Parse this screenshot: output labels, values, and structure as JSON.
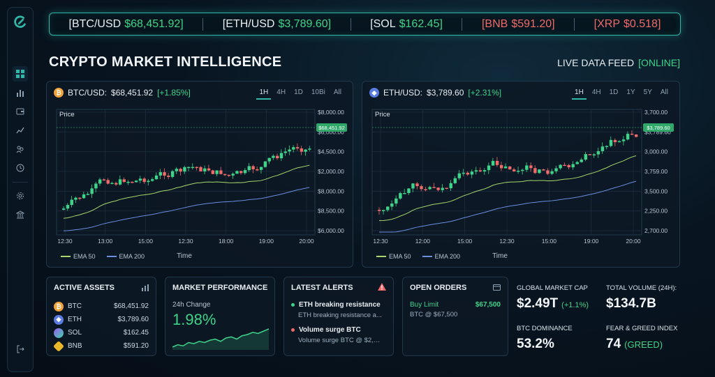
{
  "ticker": [
    {
      "pair": "[BTC/USD",
      "price": "$68,451.92]",
      "trend": "up"
    },
    {
      "pair": "[ETH/USD",
      "price": "$3,789.60]",
      "trend": "up"
    },
    {
      "pair": "[SOL",
      "price": "$162.45]",
      "trend": "up"
    },
    {
      "pair": "[BNB",
      "price": "$591.20]",
      "trend": "down"
    },
    {
      "pair": "[XRP",
      "price": "$0.518]",
      "trend": "down"
    }
  ],
  "page_title": "CRYPTO MARKET INTELLIGENCE",
  "live_feed": {
    "label": "LIVE DATA FEED",
    "status": "[ONLINE]"
  },
  "btc_chart": {
    "symbol": "BTC/USD:",
    "price": "$68,451.92",
    "change": "[+1.85%]",
    "tabs": [
      "1H",
      "4H",
      "1D",
      "10Bi",
      "All"
    ],
    "active_tab": "1H",
    "price_label": "Price",
    "time_label": "Time",
    "y_ticks": [
      "$8,000.00",
      "$6,000.00",
      "$4,500.00",
      "$2,000.00",
      "$8,000.00",
      "$8,500.00",
      "$6,000.00"
    ],
    "x_ticks": [
      "12:30",
      "13:00",
      "15:00",
      "12:30",
      "18:00",
      "19:00",
      "20:00"
    ],
    "last_price_tag": "$68,451.92",
    "legend": [
      "EMA 50",
      "EMA 200"
    ]
  },
  "eth_chart": {
    "symbol": "ETH/USD:",
    "price": "$3,789.60",
    "change": "[+2.31%]",
    "tabs": [
      "1H",
      "4H",
      "1D",
      "1Y",
      "5Y",
      "All"
    ],
    "active_tab": "1H",
    "price_label": "Price",
    "time_label": "Time",
    "y_ticks": [
      "3,700.00",
      "$3,789.60",
      "3,000.00",
      "3,759.00",
      "3,500.00",
      "2,250.00",
      "2,700.00"
    ],
    "x_ticks": [
      "12:30",
      "12:00",
      "15:00",
      "12:30",
      "15:00",
      "19:00",
      "20:00"
    ],
    "last_price_tag": "$3,789.60",
    "legend": [
      "EMA 50",
      "EMA 200"
    ]
  },
  "active_assets": {
    "title": "ACTIVE ASSETS",
    "rows": [
      {
        "symbol": "BTC",
        "price": "$68,451.92",
        "icon": "btc"
      },
      {
        "symbol": "ETH",
        "price": "$3,789.60",
        "icon": "eth"
      },
      {
        "symbol": "SOL",
        "price": "$162.45",
        "icon": "sol"
      },
      {
        "symbol": "BNB",
        "price": "$591.20",
        "icon": "bnb"
      }
    ]
  },
  "market_performance": {
    "title": "MARKET PERFORMANCE",
    "label": "24h Change",
    "value": "1.98%",
    "sparkline": [
      22,
      20,
      21,
      18,
      19,
      17,
      18,
      16,
      15,
      17,
      14,
      13,
      15,
      12,
      11,
      9,
      10,
      8,
      6
    ]
  },
  "latest_alerts": {
    "title": "LATEST ALERTS",
    "items": [
      {
        "title": "ETH breaking resistance",
        "detail": "ETH breaking resistance a...",
        "color": "#3ed48a"
      },
      {
        "title": "Volume surge BTC",
        "detail": "Volume surge BTC @ $2,0...",
        "color": "#f06a6a"
      }
    ]
  },
  "open_orders": {
    "title": "OPEN ORDERS",
    "type": "Buy Limit",
    "amount": "$67,500",
    "detail": "BTC @ $67,500"
  },
  "stats": {
    "market_cap": {
      "label": "GLOBAL MARKET CAP",
      "value": "$2.49T",
      "change": "(+1.1%)"
    },
    "volume": {
      "label": "TOTAL VOLUME (24H):",
      "value": "$134.7B"
    },
    "dominance": {
      "label": "BTC DOMINANCE",
      "value": "53.2%"
    },
    "fear_greed": {
      "label": "FEAR & GREED INDEX",
      "value": "74",
      "sentiment": "(GREED)"
    }
  },
  "colors": {
    "up": "#3ed48a",
    "down": "#f06a6a",
    "accent": "#2fb7a8",
    "ema50": "#a8d86a",
    "ema200": "#6a8fe0"
  }
}
